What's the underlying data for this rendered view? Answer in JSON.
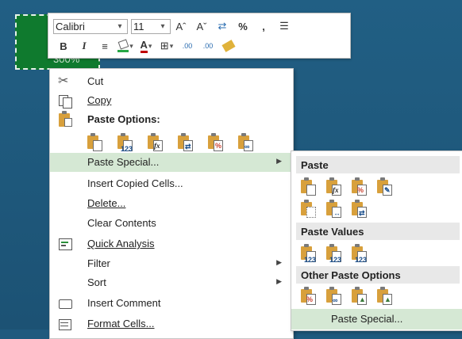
{
  "cell": {
    "value": "300%"
  },
  "mini_toolbar": {
    "font": "Calibri",
    "size": "11",
    "row1": [
      "Aˆ",
      "Aˇ",
      "⇄",
      "%",
      ",",
      "☰"
    ],
    "row2": [
      "B",
      "I",
      "≡",
      "A",
      "⊞",
      ".00",
      "🖌"
    ]
  },
  "menu": {
    "cut": "Cut",
    "copy": "Copy",
    "paste_options": "Paste Options:",
    "paste_special": "Paste Special...",
    "insert_copied": "Insert Copied Cells...",
    "delete": "Delete...",
    "clear": "Clear Contents",
    "quick_analysis": "Quick Analysis",
    "filter": "Filter",
    "sort": "Sort",
    "insert_comment": "Insert Comment",
    "format_cells": "Format Cells..."
  },
  "submenu": {
    "paste": "Paste",
    "paste_values": "Paste Values",
    "other": "Other Paste Options",
    "paste_special": "Paste Special..."
  },
  "paste_glyphs": [
    "123",
    "fx",
    "%",
    "123"
  ],
  "colors": {
    "accent_highlight": "#d5e8d4",
    "cell_green": "#0f7a2e",
    "clipboard": "#d8a03c"
  }
}
